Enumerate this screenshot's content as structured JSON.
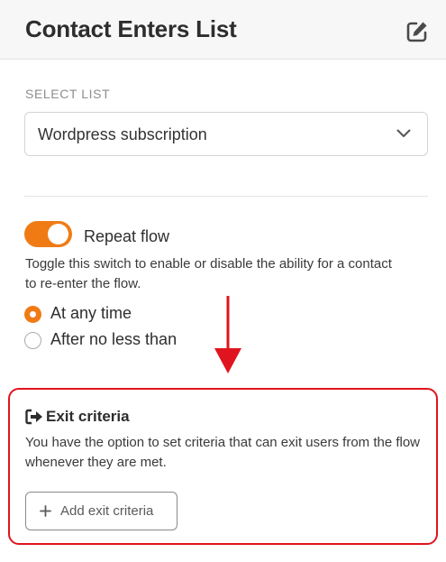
{
  "header": {
    "title": "Contact Enters List",
    "edit_icon": "edit-icon"
  },
  "select_list": {
    "label": "SELECT LIST",
    "value": "Wordpress subscription",
    "chevron_icon": "chevron-down-icon"
  },
  "repeat_flow": {
    "label": "Repeat flow",
    "enabled": true,
    "help_text": "Toggle this switch to enable or disable the ability for a contact to re-enter the flow.",
    "options": [
      {
        "label": "At any time",
        "selected": true
      },
      {
        "label": "After no less than",
        "selected": false
      }
    ]
  },
  "exit_criteria": {
    "icon": "sign-out-icon",
    "title": "Exit criteria",
    "description": "You have the option to set criteria that can exit users from the flow whenever they are met.",
    "add_button": "Add exit criteria",
    "add_icon": "plus-icon"
  },
  "colors": {
    "accent": "#f07b15",
    "annotation_red": "#e0141e",
    "header_bg": "#f7f7f7"
  }
}
